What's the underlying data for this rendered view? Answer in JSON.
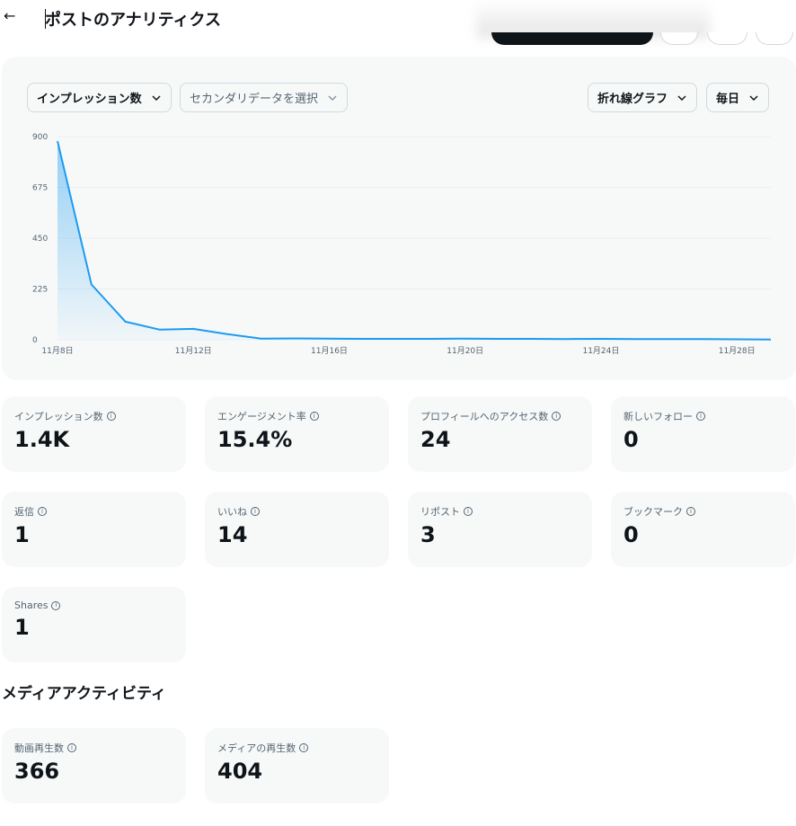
{
  "header": {
    "back_icon": "arrow-left-icon",
    "back_glyph": "←",
    "title": "ポストのアナリティクス"
  },
  "controls": {
    "primary_metric": "インプレッション数",
    "secondary_metric": "セカンダリデータを選択",
    "chart_type": "折れ線グラフ",
    "interval": "毎日"
  },
  "chart_data": {
    "type": "area",
    "title": "",
    "xlabel": "",
    "ylabel": "",
    "ylim": [
      0,
      900
    ],
    "yticks": [
      "900",
      "675",
      "450",
      "225",
      "0"
    ],
    "ytick_values": [
      900,
      675,
      450,
      225,
      0
    ],
    "xtick_labels": [
      "11月8日",
      "11月12日",
      "11月16日",
      "11月20日",
      "11月24日",
      "11月28日"
    ],
    "xtick_days": [
      8,
      12,
      16,
      20,
      24,
      28
    ],
    "grid": true,
    "legend": "none",
    "color": "#1d9bf0",
    "series": [
      {
        "name": "インプレッション数",
        "x": [
          8,
          9,
          10,
          11,
          12,
          13,
          14,
          15,
          16,
          17,
          18,
          19,
          20,
          21,
          22,
          23,
          24,
          25,
          26,
          27,
          28,
          29
        ],
        "values": [
          880,
          245,
          80,
          45,
          48,
          25,
          5,
          6,
          5,
          4,
          4,
          4,
          5,
          4,
          4,
          3,
          4,
          3,
          3,
          3,
          2,
          1
        ]
      }
    ]
  },
  "stats": [
    {
      "label": "インプレッション数",
      "value": "1.4K"
    },
    {
      "label": "エンゲージメント率",
      "value": "15.4%"
    },
    {
      "label": "プロフィールへのアクセス数",
      "value": "24"
    },
    {
      "label": "新しいフォロー",
      "value": "0"
    },
    {
      "label": "返信",
      "value": "1"
    },
    {
      "label": "いいね",
      "value": "14"
    },
    {
      "label": "リポスト",
      "value": "3"
    },
    {
      "label": "ブックマーク",
      "value": "0"
    },
    {
      "label": "Shares",
      "value": "1"
    }
  ],
  "media_section": {
    "title": "メディアアクティビティ",
    "stats": [
      {
        "label": "動画再生数",
        "value": "366"
      },
      {
        "label": "メディアの再生数",
        "value": "404"
      }
    ]
  },
  "info_glyph": "i"
}
